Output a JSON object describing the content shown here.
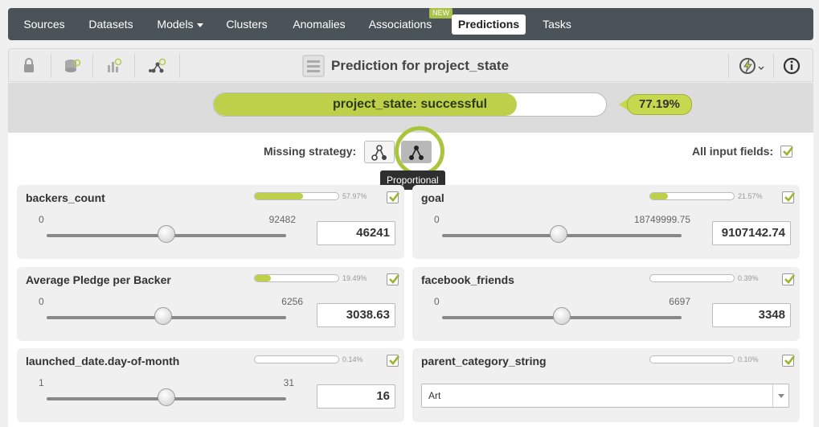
{
  "nav": {
    "items": [
      "Sources",
      "Datasets",
      "Models",
      "Clusters",
      "Anomalies",
      "Associations",
      "Predictions",
      "Tasks"
    ],
    "active": "Predictions",
    "new_badge": "NEW"
  },
  "header": {
    "title": "Prediction for project_state"
  },
  "result": {
    "label": "project_state: successful",
    "confidence": "77.19%",
    "confidence_fraction": 0.7719
  },
  "options": {
    "missing_strategy_label": "Missing strategy:",
    "tooltip": "Proportional",
    "all_input_label": "All input fields:"
  },
  "fields": [
    {
      "name": "backers_count",
      "importance": "57.97%",
      "importance_fraction": 0.5797,
      "min": "0",
      "max": "92482",
      "value": "46241",
      "slider_fraction": 0.5
    },
    {
      "name": "goal",
      "importance": "21.57%",
      "importance_fraction": 0.2157,
      "min": "0",
      "max": "18749999.75",
      "value": "9107142.74",
      "slider_fraction": 0.485
    },
    {
      "name": "Average Pledge per Backer",
      "importance": "19.49%",
      "importance_fraction": 0.1949,
      "min": "0",
      "max": "6256",
      "value": "3038.63",
      "slider_fraction": 0.485
    },
    {
      "name": "facebook_friends",
      "importance": "0.39%",
      "importance_fraction": 0.0039,
      "min": "0",
      "max": "6697",
      "value": "3348",
      "slider_fraction": 0.5
    },
    {
      "name": "launched_date.day-of-month",
      "importance": "0.14%",
      "importance_fraction": 0.0014,
      "min": "1",
      "max": "31",
      "value": "16",
      "slider_fraction": 0.5
    },
    {
      "name": "parent_category_string",
      "importance": "0.10%",
      "importance_fraction": 0.001,
      "select_value": "Art"
    }
  ],
  "colors": {
    "nav_bg": "#4a5358",
    "accent_green": "#bcd04a",
    "ring_green": "#a9c53b"
  }
}
